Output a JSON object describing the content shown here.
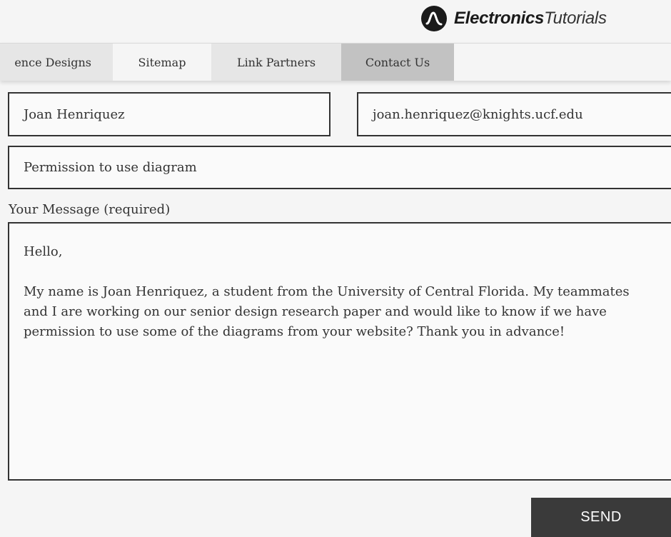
{
  "header": {
    "logo_bold": "Electronics",
    "logo_light": "Tutorials",
    "logo_icon": "sine-wave-icon"
  },
  "nav": {
    "items": [
      {
        "label": "ence Designs"
      },
      {
        "label": "Sitemap"
      },
      {
        "label": "Link Partners"
      },
      {
        "label": "Contact Us",
        "active": true
      }
    ]
  },
  "form": {
    "name_value": "Joan Henriquez",
    "email_value": "joan.henriquez@knights.ucf.edu",
    "subject_value": "Permission to use diagram",
    "message_label": "Your Message (required)",
    "message_paragraphs": [
      "Hello,",
      "My name is Joan Henriquez, a student from the University of Central Florida. My teammates and I are working on our senior design research paper and would like to know if we have permission to use some of the diagrams from your website? Thank you in advance!"
    ],
    "send_label": "SEND"
  },
  "colors": {
    "nav_active": "#c2c2c2",
    "nav_grey": "#e6e6e6",
    "button_bg": "#3a3a3a",
    "border": "#333333"
  }
}
